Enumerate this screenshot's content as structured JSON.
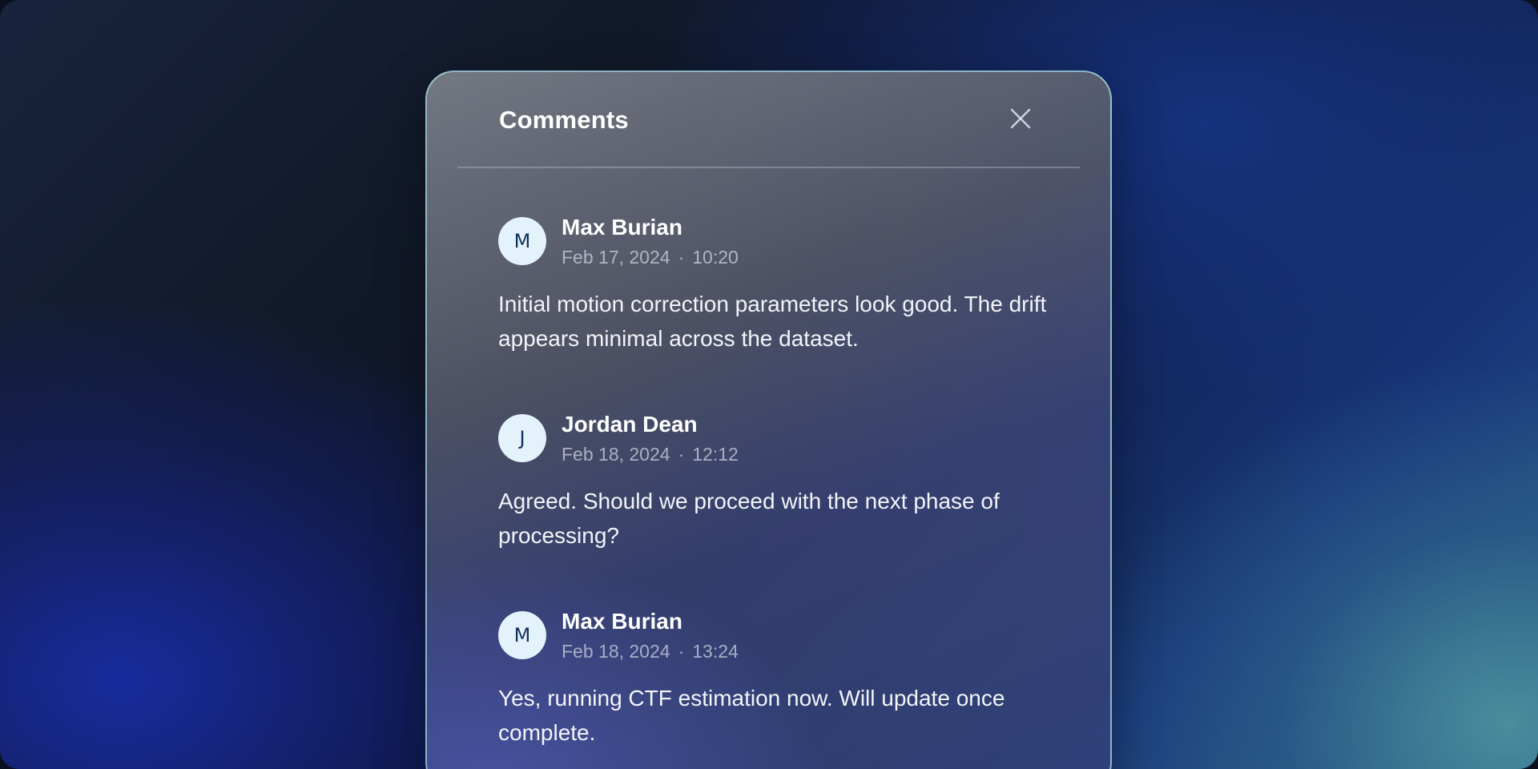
{
  "panel": {
    "title": "Comments",
    "close_icon": "close-icon"
  },
  "comments": [
    {
      "initial": "M",
      "author": "Max Burian",
      "date": "Feb 17, 2024",
      "separator": "·",
      "time": "10:20",
      "text": "Initial motion correction parameters look good. The drift appears minimal across the dataset."
    },
    {
      "initial": "J",
      "author": "Jordan Dean",
      "date": "Feb 18, 2024",
      "separator": "·",
      "time": "12:12",
      "text": "Agreed. Should we proceed with the next phase of processing?"
    },
    {
      "initial": "M",
      "author": "Max Burian",
      "date": "Feb 18, 2024",
      "separator": "·",
      "time": "13:24",
      "text": "Yes, running CTF estimation now. Will update once complete."
    }
  ],
  "colors": {
    "avatar_bg": "#e3f2fb",
    "avatar_text": "#12325a",
    "panel_border": "#aadce1"
  }
}
